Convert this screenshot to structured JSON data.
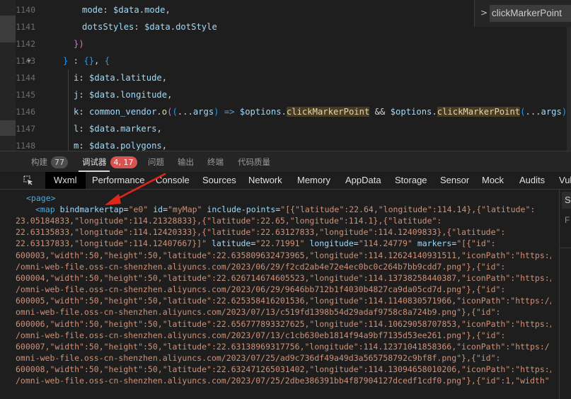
{
  "editor": {
    "line_numbers": [
      "1140",
      "1141",
      "1142",
      "1143",
      "1144",
      "1145",
      "1146",
      "1147",
      "1148"
    ],
    "lines": [
      [
        {
          "t": "mode",
          "c": "var"
        },
        {
          "t": ": ",
          "c": "p"
        },
        {
          "t": "$data",
          "c": "var"
        },
        {
          "t": ".",
          "c": "p"
        },
        {
          "t": "mode",
          "c": "var"
        },
        {
          "t": ",",
          "c": "p"
        }
      ],
      [
        {
          "t": "dotsStyles",
          "c": "var"
        },
        {
          "t": ": ",
          "c": "p"
        },
        {
          "t": "$data",
          "c": "var"
        },
        {
          "t": ".",
          "c": "p"
        },
        {
          "t": "dotStyle",
          "c": "var"
        }
      ],
      [
        {
          "t": "})",
          "c": "br"
        }
      ],
      [
        {
          "t": "}",
          "c": "br3"
        },
        {
          "t": " : ",
          "c": "p"
        },
        {
          "t": "{}",
          "c": "br3"
        },
        {
          "t": ", ",
          "c": "p"
        },
        {
          "t": "{",
          "c": "br3"
        }
      ],
      [
        {
          "t": "i",
          "c": "var"
        },
        {
          "t": ": ",
          "c": "p"
        },
        {
          "t": "$data",
          "c": "var"
        },
        {
          "t": ".",
          "c": "p"
        },
        {
          "t": "latitude",
          "c": "var"
        },
        {
          "t": ",",
          "c": "p"
        }
      ],
      [
        {
          "t": "j",
          "c": "var"
        },
        {
          "t": ": ",
          "c": "p"
        },
        {
          "t": "$data",
          "c": "var"
        },
        {
          "t": ".",
          "c": "p"
        },
        {
          "t": "longitude",
          "c": "var"
        },
        {
          "t": ",",
          "c": "p"
        }
      ],
      [
        {
          "t": "k",
          "c": "var"
        },
        {
          "t": ": ",
          "c": "p"
        },
        {
          "t": "common_vendor",
          "c": "var"
        },
        {
          "t": ".",
          "c": "p"
        },
        {
          "t": "o",
          "c": "fn"
        },
        {
          "t": "(",
          "c": "br"
        },
        {
          "t": "(",
          "c": "br3"
        },
        {
          "t": "...",
          "c": "p"
        },
        {
          "t": "args",
          "c": "var"
        },
        {
          "t": ") ",
          "c": "br3"
        },
        {
          "t": "=> ",
          "c": "kw"
        },
        {
          "t": "$options",
          "c": "var"
        },
        {
          "t": ".",
          "c": "p"
        },
        {
          "t": "clickMarkerPoint",
          "c": "fn",
          "hl": true
        },
        {
          "t": " && ",
          "c": "p"
        },
        {
          "t": "$options",
          "c": "var"
        },
        {
          "t": ".",
          "c": "p"
        },
        {
          "t": "clickMarkerPoint",
          "c": "fn",
          "hl": true
        },
        {
          "t": "(",
          "c": "br3"
        },
        {
          "t": "...",
          "c": "p"
        },
        {
          "t": "args",
          "c": "var"
        },
        {
          "t": ")",
          "c": "br3"
        },
        {
          "t": ")",
          "c": "br"
        },
        {
          "t": ",",
          "c": "p"
        }
      ],
      [
        {
          "t": "l",
          "c": "var"
        },
        {
          "t": ": ",
          "c": "p"
        },
        {
          "t": "$data",
          "c": "var"
        },
        {
          "t": ".",
          "c": "p"
        },
        {
          "t": "markers",
          "c": "var"
        },
        {
          "t": ",",
          "c": "p"
        }
      ],
      [
        {
          "t": "m",
          "c": "var"
        },
        {
          "t": ": ",
          "c": "p"
        },
        {
          "t": "$data",
          "c": "var"
        },
        {
          "t": ".",
          "c": "p"
        },
        {
          "t": "polygons",
          "c": "var"
        },
        {
          "t": ",",
          "c": "p"
        }
      ]
    ],
    "sticky_chevron": ">",
    "sticky_text": "clickMarkerPoint"
  },
  "panel_tabs": [
    {
      "label": "构建",
      "count": "77",
      "count_style": "grey"
    },
    {
      "label": "调试器",
      "count": "4, 17",
      "count_style": "red",
      "active": true
    },
    {
      "label": "问题"
    },
    {
      "label": "输出"
    },
    {
      "label": "终端"
    },
    {
      "label": "代码质量"
    }
  ],
  "devtools_tabs": [
    "Wxml",
    "Performance",
    "Console",
    "Sources",
    "Network",
    "Memory",
    "AppData",
    "Storage",
    "Sensor",
    "Mock",
    "Audits",
    "Vul"
  ],
  "wxml": {
    "line1": "<page>",
    "lines": [
      [
        {
          "t": "<map ",
          "c": "tag"
        },
        {
          "t": "bindmarkertap",
          "c": "attr"
        },
        {
          "t": "=",
          "c": "eq"
        },
        {
          "t": "\"e0\"",
          "c": "aval"
        },
        {
          "t": " id",
          "c": "attr"
        },
        {
          "t": "=",
          "c": "eq"
        },
        {
          "t": "\"myMap\"",
          "c": "aval"
        },
        {
          "t": " include-points",
          "c": "attr"
        },
        {
          "t": "=",
          "c": "eq"
        },
        {
          "t": "\"[{\"latitude\":22.64,\"longitude\":114.14},{\"latitude\":",
          "c": "aval"
        }
      ],
      [
        {
          "t": "23.05184833,\"longitude\":114.21328833},{\"latitude\":22.65,\"longitude\":114.1},{\"latitude\":",
          "c": "aval"
        }
      ],
      [
        {
          "t": "22.63135833,\"longitude\":114.12420333},{\"latitude\":22.63127833,\"longitude\":114.12409833},{\"latitude\":",
          "c": "aval"
        }
      ],
      [
        {
          "t": "22.63137833,\"longitude\":114.12407667}]\"",
          "c": "aval"
        },
        {
          "t": " latitude",
          "c": "attr"
        },
        {
          "t": "=",
          "c": "eq"
        },
        {
          "t": "\"22.71991\"",
          "c": "aval"
        },
        {
          "t": " longitude",
          "c": "attr"
        },
        {
          "t": "=",
          "c": "eq"
        },
        {
          "t": "\"114.24779\"",
          "c": "aval"
        },
        {
          "t": " markers",
          "c": "attr"
        },
        {
          "t": "=",
          "c": "eq"
        },
        {
          "t": "\"[{\"id\":",
          "c": "aval"
        }
      ],
      [
        {
          "t": "600003,\"width\":50,\"height\":50,\"latitude\":22.635809632473965,\"longitude\":114.12624140931511,\"iconPath\":\"https:/",
          "c": "aval"
        }
      ],
      [
        {
          "t": "/omni-web-file.oss-cn-shenzhen.aliyuncs.com/2023/06/29/f2cd2ab4e72e4ec0bc0c264b7bb9cdd7.png\"},{\"id\":",
          "c": "aval"
        }
      ],
      [
        {
          "t": "600004,\"width\":50,\"height\":50,\"latitude\":22.626714674605523,\"longitude\":114.13738258440387,\"iconPath\":\"https:/",
          "c": "aval"
        }
      ],
      [
        {
          "t": "/omni-web-file.oss-cn-shenzhen.aliyuncs.com/2023/06/29/9646bb712b1f4030b4827ca9da05cd7d.png\"},{\"id\":",
          "c": "aval"
        }
      ],
      [
        {
          "t": "600005,\"width\":50,\"height\":50,\"latitude\":22.625358416201536,\"longitude\":114.1140830571966,\"iconPath\":\"https://",
          "c": "aval"
        }
      ],
      [
        {
          "t": "omni-web-file.oss-cn-shenzhen.aliyuncs.com/2023/07/13/c519fd1398b54d29adaf9758c8a724b9.png\"},{\"id\":",
          "c": "aval"
        }
      ],
      [
        {
          "t": "600006,\"width\":50,\"height\":50,\"latitude\":22.656777893327625,\"longitude\":114.10629058707853,\"iconPath\":\"https:/",
          "c": "aval"
        }
      ],
      [
        {
          "t": "/omni-web-file.oss-cn-shenzhen.aliyuncs.com/2023/07/13/c1cb630eb1814f94a9bf7135d53ee261.png\"},{\"id\":",
          "c": "aval"
        }
      ],
      [
        {
          "t": "600007,\"width\":50,\"height\":50,\"latitude\":22.63138969317756,\"longitude\":114.12371041858366,\"iconPath\":\"https:/",
          "c": "aval"
        }
      ],
      [
        {
          "t": "omni-web-file.oss-cn-shenzhen.aliyuncs.com/2023/07/25/ad9c736df49a49d3a565758792c9bf8f.png\"},{\"id\":",
          "c": "aval"
        }
      ],
      [
        {
          "t": "600008,\"width\":50,\"height\":50,\"latitude\":22.632471265031402,\"longitude\":114.13094658010206,\"iconPath\":\"https:/",
          "c": "aval"
        }
      ],
      [
        {
          "t": "/omni-web-file.oss-cn-shenzhen.aliyuncs.com/2023/07/25/2dbe386391bb4f87904127dcedf1cdf0.png\"},{\"id\":1,\"width\":",
          "c": "aval"
        }
      ]
    ]
  },
  "side_panel": {
    "s_label": "S",
    "f_label": "F"
  },
  "colors": {
    "accent_red": "#d9534f",
    "annotation_arrow": "#e0261b"
  }
}
